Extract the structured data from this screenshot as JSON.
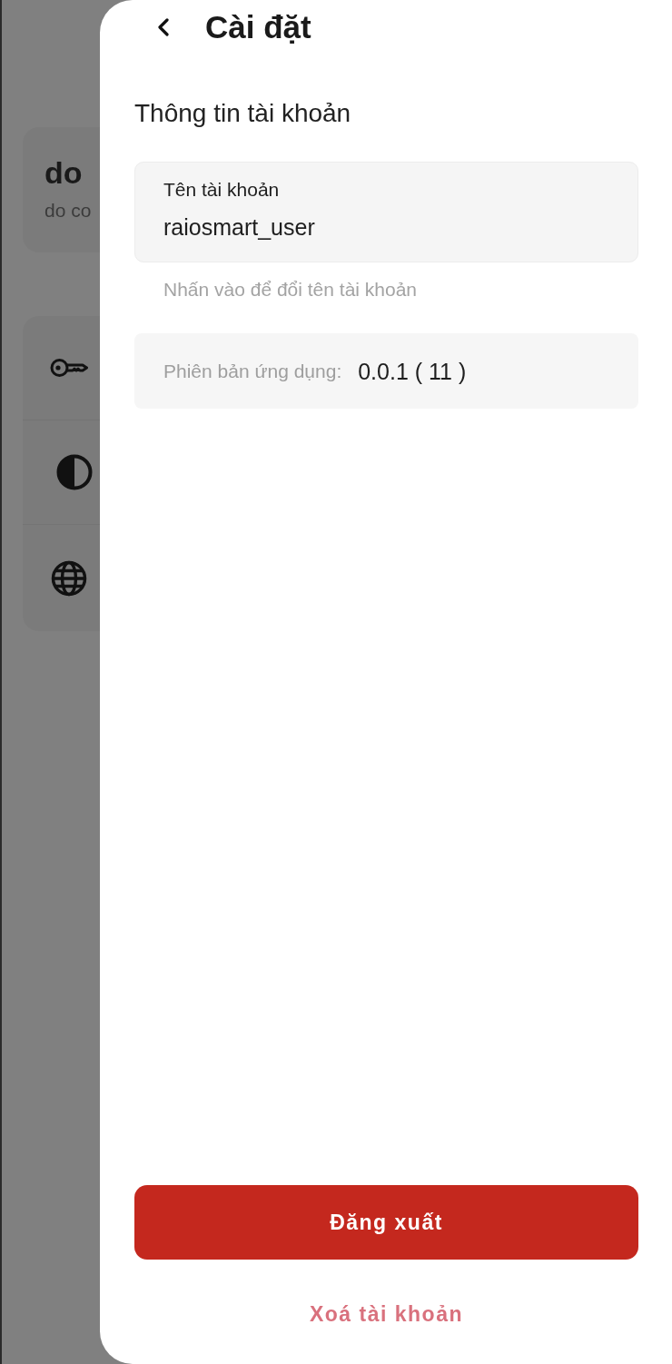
{
  "background": {
    "profile": {
      "name": "do",
      "subtitle": "do co"
    }
  },
  "sheet": {
    "title": "Cài đặt",
    "section_title": "Thông tin tài khoản",
    "account_field": {
      "label": "Tên tài khoản",
      "value": "raiosmart_user"
    },
    "hint": "Nhấn vào để đổi tên tài khoản",
    "version": {
      "label": "Phiên bản ứng dụng:",
      "value": "0.0.1 ( 11 )"
    },
    "actions": [
      {
        "kind": "primary",
        "label": "Đăng xuất"
      },
      {
        "kind": "destructive_link",
        "label": "Xoá tài khoản"
      }
    ]
  }
}
